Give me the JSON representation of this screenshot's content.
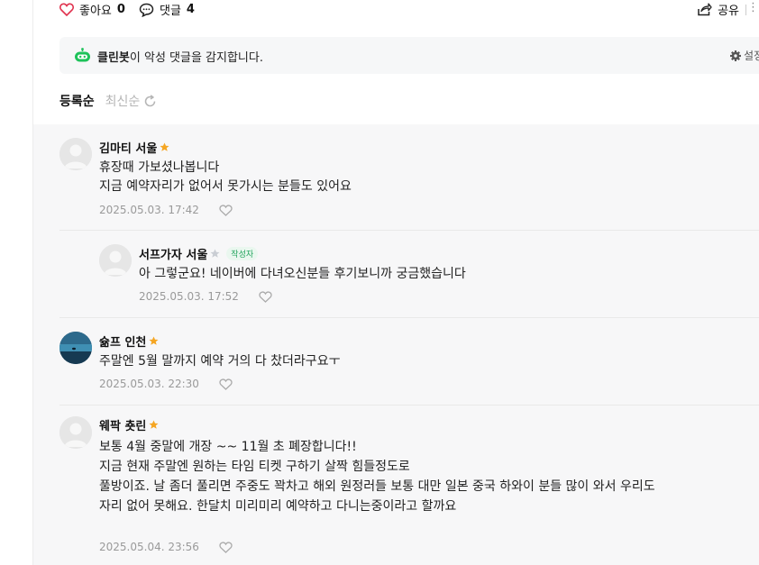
{
  "reactions": {
    "like_label": "좋아요",
    "like_count": "0",
    "comment_label": "댓글",
    "comment_count": "4",
    "share_label": "공유"
  },
  "cleanbot": {
    "name": "클린봇",
    "message": "이 악성 댓글을 감지합니다.",
    "settings_label": "설정"
  },
  "sort": {
    "active": "등록순",
    "inactive": "최신순"
  },
  "colors": {
    "heart": "#e0334f",
    "bot_green": "#1ec25a",
    "star": "#f5a623",
    "author_badge": "#1fa35a"
  },
  "comments": [
    {
      "author": "김마티 서울",
      "lines": [
        "휴장때 가보셨나봅니다",
        "지금 예약자리가 없어서 못가시는 분들도 있어요"
      ],
      "date": "2025.05.03. 17:42"
    },
    {
      "author": "서프가자 서울",
      "badge": "작성자",
      "lines": [
        "아 그렇군요! 네이버에 다녀오신분들 후기보니까 궁금했습니다"
      ],
      "date": "2025.05.03. 17:52"
    },
    {
      "author": "슒프 인천",
      "lines": [
        "주말엔 5월 말까지 예약 거의 다 찼더라구요ㅜ"
      ],
      "date": "2025.05.03. 22:30"
    },
    {
      "author": "웨팍 춋린",
      "lines": [
        "보통 4월 중말에 개장 ~~ 11월 초 폐장합니다!!",
        "지금 현재 주말엔 원하는 타임 티켓 구하기 살짝 힘들정도로",
        "풀방이죠. 날 좀더 풀리면 주중도 꽉차고 해외 원정러들 보통 대만 일본 중국 하와이 분들 많이 와서 우리도",
        "자리 없어 못해요. 한달치 미리미리 예약하고 다니는중이라고 할까요"
      ],
      "date": "2025.05.04. 23:56"
    }
  ]
}
